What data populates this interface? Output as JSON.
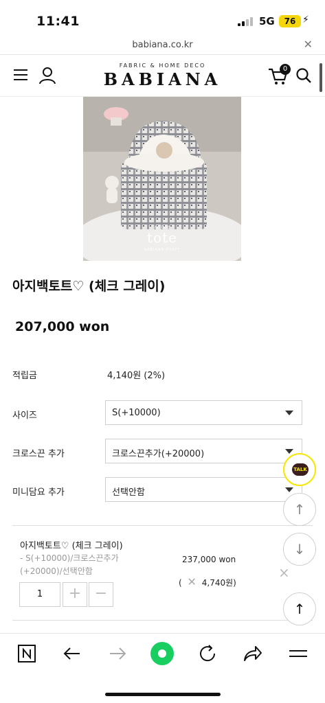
{
  "status": {
    "time": "11:41",
    "network": "5G",
    "battery": "76"
  },
  "browser": {
    "url": "babiana.co.kr"
  },
  "header": {
    "brand_sub": "FABRIC & HOME DECO",
    "brand_name": "BABIANA",
    "cart_count": "0"
  },
  "image": {
    "caption_small": "aji bag",
    "caption": "tote",
    "caption_brand": "BABIANA PUPPY"
  },
  "product": {
    "title": "아지백토트♡ (체크 그레이)",
    "price": "207,000 won",
    "points_label": "적립금",
    "points_value": "4,140원 (2%)",
    "options": [
      {
        "label": "사이즈",
        "value": "S(+10000)"
      },
      {
        "label": "크로스끈 추가",
        "value": "크로스끈추가(+20000)"
      },
      {
        "label": "미니담요 추가",
        "value": "선택안함"
      }
    ]
  },
  "selected_option": {
    "name": "아지백토트♡ (체크 그레이)",
    "detail": "- S(+10000)/크로스끈추가(+20000)/선택안함",
    "price": "237,000 won",
    "points": "4,740원)",
    "points_open": "(",
    "quantity": "1",
    "plus": "+",
    "minus": "−",
    "remove": "×"
  },
  "floating": {
    "talk": "TALK",
    "up": "↑",
    "down": "↓",
    "top": "↑"
  }
}
